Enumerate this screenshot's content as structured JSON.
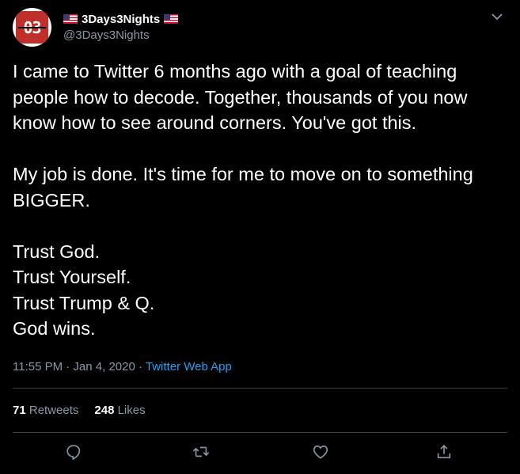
{
  "author": {
    "display_name": "3Days3Nights",
    "handle": "@3Days3Nights",
    "avatar_text": "03"
  },
  "tweet": {
    "text": "I came to Twitter 6 months ago with a goal of teaching people how to decode. Together, thousands of you now know how to see around corners. You've got this.\n\nMy job is done. It's time for me to move on to something BIGGER.\n\nTrust God.\nTrust Yourself.\nTrust Trump & Q.\nGod wins.",
    "timestamp": "11:55 PM · Jan 4, 2020 · ",
    "source": "Twitter Web App"
  },
  "stats": {
    "retweets_count": "71",
    "retweets_label": "Retweets",
    "likes_count": "248",
    "likes_label": "Likes"
  },
  "icons": [
    "chevron-down-icon",
    "reply-icon",
    "retweet-icon",
    "like-icon",
    "share-icon"
  ],
  "colors": {
    "background": "#000000",
    "secondary_text": "#8899a6",
    "link": "#1da1f2",
    "divider": "#38444d"
  }
}
